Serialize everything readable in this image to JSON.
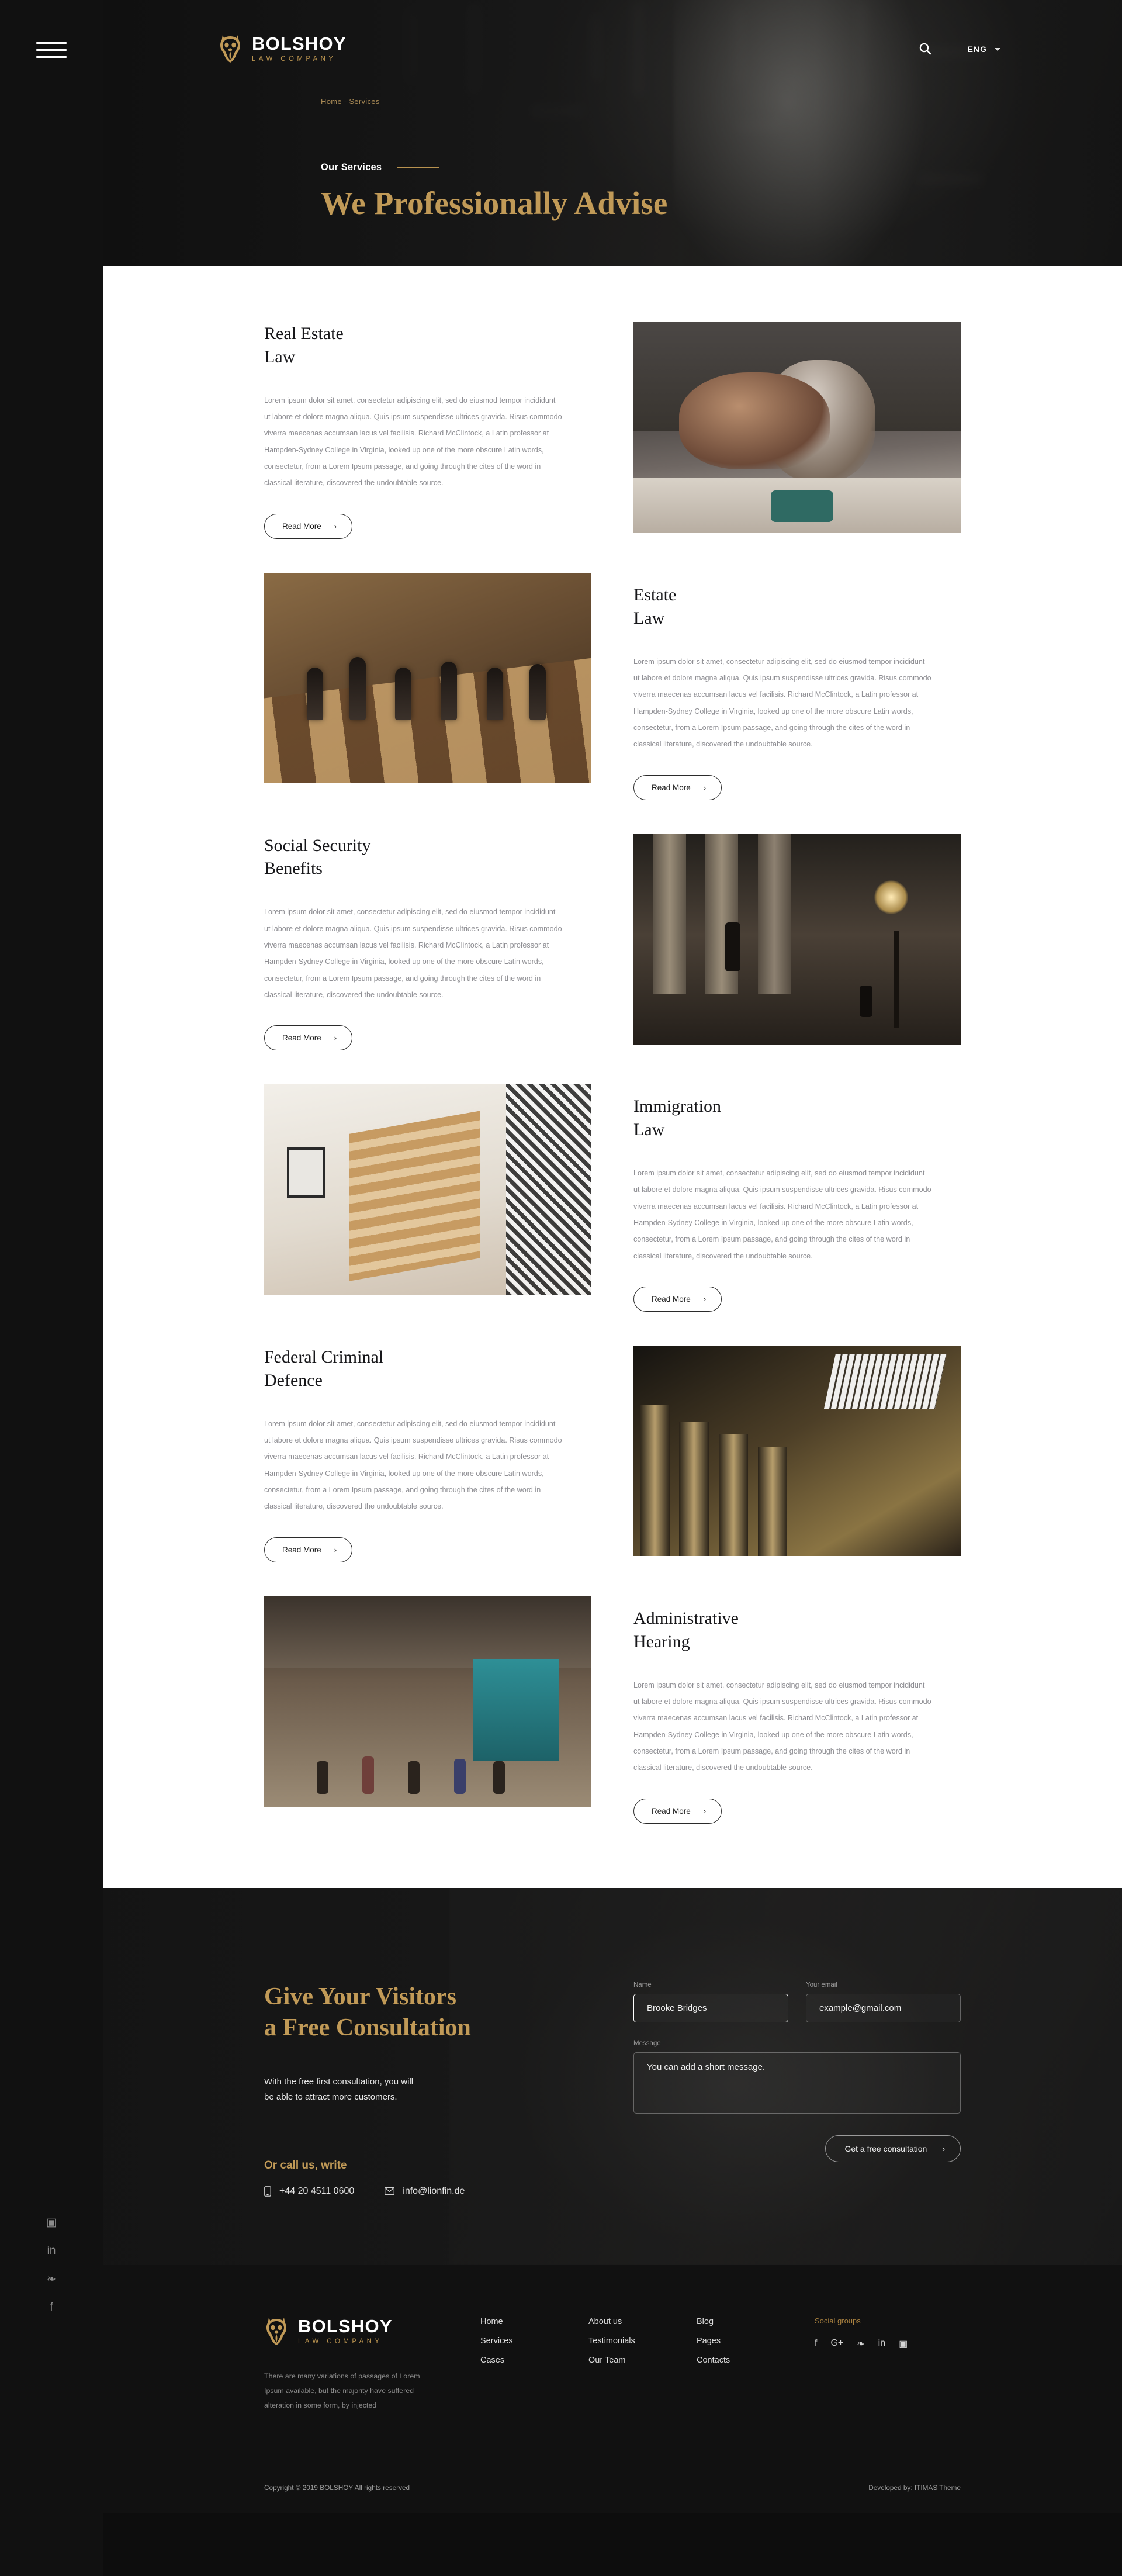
{
  "brand": {
    "name": "BOLSHOY",
    "tagline": "LAW COMPANY",
    "logo_icon": "lion-head-icon"
  },
  "header": {
    "menu_icon": "hamburger-menu-icon",
    "search_icon": "search-icon",
    "language": "ENG",
    "caret_icon": "chevron-down-icon"
  },
  "hero": {
    "breadcrumb": "Home - Services",
    "eyebrow": "Our Services",
    "title": "We Professionally Advise"
  },
  "rail_social": [
    {
      "name": "instagram",
      "glyph": "▣"
    },
    {
      "name": "linkedin",
      "glyph": "in"
    },
    {
      "name": "twitter",
      "glyph": "❧"
    },
    {
      "name": "facebook",
      "glyph": "f"
    }
  ],
  "services": {
    "body": "Lorem ipsum dolor sit amet, consectetur adipiscing elit, sed do eiusmod tempor incididunt ut labore et dolore magna aliqua. Quis ipsum suspendisse ultrices gravida. Risus commodo viverra maecenas accumsan lacus vel facilisis.  Richard McClintock, a Latin professor at Hampden-Sydney College in Virginia, looked up one of the more obscure Latin words, consectetur, from a Lorem Ipsum passage, and going through the cites of the word in classical literature, discovered the undoubtable source.",
    "read_more": "Read More",
    "chevron": "›",
    "items": [
      {
        "title_line1": "Real Estate",
        "title_line2": "Law",
        "image": "kitchen-photo",
        "side": "left"
      },
      {
        "title_line1": "Estate",
        "title_line2": "Law",
        "image": "chessboard-photo",
        "side": "right"
      },
      {
        "title_line1": "Social Security",
        "title_line2": "Benefits",
        "image": "courthouse-steps-photo",
        "side": "left"
      },
      {
        "title_line1": "Immigration",
        "title_line2": "Law",
        "image": "staircase-photo",
        "side": "right"
      },
      {
        "title_line1": "Federal Criminal",
        "title_line2": "Defence",
        "image": "columns-ceiling-photo",
        "side": "left"
      },
      {
        "title_line1": "Administrative",
        "title_line2": "Hearing",
        "image": "market-alley-photo",
        "side": "right"
      }
    ]
  },
  "consultation": {
    "title_line1": "Give Your Visitors",
    "title_line2": "a Free Consultation",
    "subtitle_line1": "With the free first consultation, you will",
    "subtitle_line2": "be able to attract more customers.",
    "or_call": "Or call us, write",
    "phone": "+44 20 4511 0600",
    "phone_icon": "mobile-phone-icon",
    "email": "info@lionfin.de",
    "email_icon": "envelope-icon",
    "form": {
      "name_label": "Name",
      "name_value": "Brooke Bridges",
      "email_label": "Your email",
      "email_value": "example@gmail.com",
      "message_label": "Message",
      "message_value": "You can add a short message.",
      "submit": "Get a free consultation",
      "submit_chevron": "›"
    }
  },
  "footer": {
    "about": "There are many variations of passages of Lorem Ipsum available, but the majority have suffered alteration in some form, by injected",
    "nav_col1": [
      "Home",
      "Services",
      "Cases"
    ],
    "nav_col2": [
      "About us",
      "Testimonials",
      "Our Team"
    ],
    "nav_col3": [
      "Blog",
      "Pages",
      "Contacts"
    ],
    "social_heading": "Social groups",
    "social": [
      {
        "name": "facebook",
        "glyph": "f"
      },
      {
        "name": "google-plus",
        "glyph": "G+"
      },
      {
        "name": "twitter",
        "glyph": "❧"
      },
      {
        "name": "linkedin",
        "glyph": "in"
      },
      {
        "name": "instagram",
        "glyph": "▣"
      }
    ],
    "copyright": "Copyright © 2019 BOLSHOY All rights reserved",
    "developed": "Developed by: ITIMAS Theme"
  },
  "colors": {
    "gold": "#c19a57",
    "dark": "#111111",
    "white": "#ffffff"
  }
}
